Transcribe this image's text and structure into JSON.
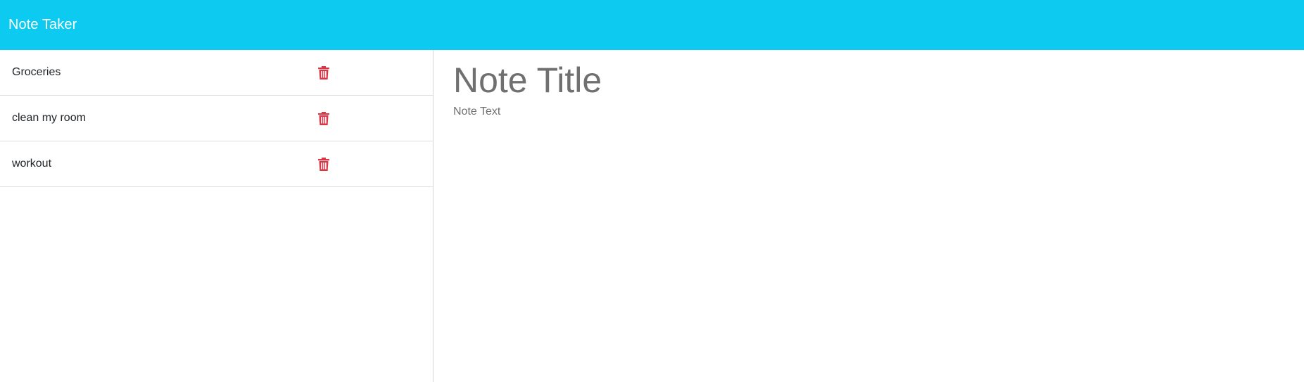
{
  "navbar": {
    "brand": "Note Taker",
    "background_color": "#0dcaf0"
  },
  "sidebar": {
    "notes": [
      {
        "label": "Groceries",
        "delete_icon": "trash-icon"
      },
      {
        "label": "clean my room",
        "delete_icon": "trash-icon"
      },
      {
        "label": "workout",
        "delete_icon": "trash-icon"
      }
    ],
    "delete_icon_color": "#dc3545"
  },
  "editor": {
    "title_placeholder": "Note Title",
    "title_value": "",
    "text_placeholder": "Note Text",
    "text_value": ""
  }
}
